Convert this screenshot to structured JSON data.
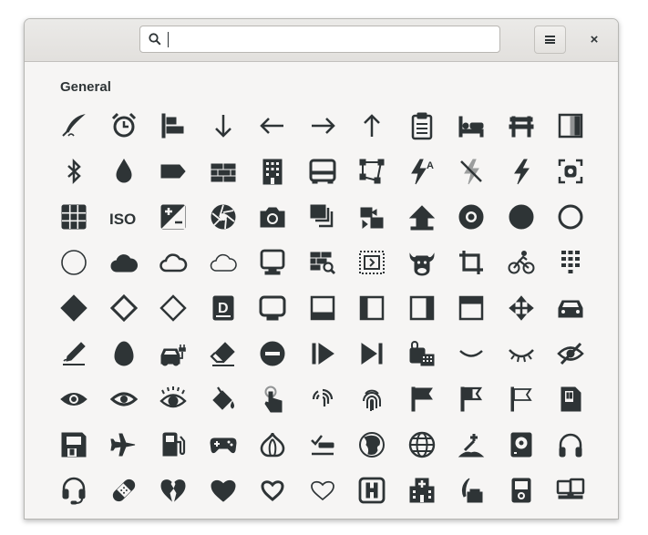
{
  "search": {
    "value": "",
    "placeholder": ""
  },
  "header": {
    "menu_icon": "open-menu-icon",
    "close_label": "×"
  },
  "section": {
    "title": "General"
  },
  "icons": [
    [
      "quill-icon",
      "alarm-clock-icon",
      "align-left-icon",
      "arrow-down-icon",
      "arrow-left-icon",
      "arrow-right-icon",
      "arrow-up-icon",
      "clipboard-list-icon",
      "bed-icon",
      "bench-icon",
      "gradient-icon"
    ],
    [
      "bluetooth-icon",
      "drop-icon",
      "label-tag-icon",
      "brick-wall-icon",
      "building-icon",
      "bus-icon",
      "vector-shape-icon",
      "flash-auto-icon",
      "flash-off-icon",
      "flash-icon",
      "focus-icon"
    ],
    [
      "grid-icon",
      "iso-icon",
      "exposure-icon",
      "aperture-icon",
      "camera-icon",
      "photo-stack-icon",
      "media-transfer-icon",
      "upload-arrow-icon",
      "disc-icon",
      "circle-filled-icon",
      "circle-thick-outline-icon"
    ],
    [
      "circle-outline-icon",
      "cloud-filled-icon",
      "cloud-outline-icon",
      "cloud-thin-icon",
      "computer-icon",
      "brick-search-icon",
      "code-frame-icon",
      "cow-icon",
      "crop-icon",
      "cyclist-icon",
      "dialpad-icon"
    ],
    [
      "diamond-filled-icon",
      "diamond-outline-icon",
      "diamond-thin-icon",
      "dictionary-icon",
      "display-icon",
      "dock-bottom-icon",
      "dock-left-icon",
      "dock-right-icon",
      "dock-top-icon",
      "move-arrows-icon",
      "car-icon"
    ],
    [
      "signature-icon",
      "egg-icon",
      "electric-car-icon",
      "eraser-icon",
      "remove-circle-icon",
      "step-forward-icon",
      "skip-next-icon",
      "keyboard-mouse-icon",
      "smile-icon",
      "eye-closed-icon",
      "eye-hidden-icon"
    ],
    [
      "eye-icon",
      "eye-outline-icon",
      "eye-lashes-icon",
      "paint-bucket-icon",
      "touch-finger-icon",
      "fingerprint-partial-icon",
      "fingerprint-icon",
      "flag-filled-icon",
      "flag-half-icon",
      "flag-outline-icon",
      "sd-card-icon"
    ],
    [
      "floppy-disk-icon",
      "airplane-icon",
      "fuel-pump-icon",
      "gamepad-icon",
      "garlic-icon",
      "checklist-icon",
      "globe-filled-icon",
      "globe-outline-icon",
      "grave-icon",
      "hard-disk-icon",
      "headphones-icon"
    ],
    [
      "headset-icon",
      "band-aid-icon",
      "heart-broken-icon",
      "heart-filled-icon",
      "heart-thick-icon",
      "heart-outline-icon",
      "hospital-sign-icon",
      "hospital-icon",
      "feather-ink-icon",
      "media-player-icon",
      "multi-monitor-icon"
    ]
  ]
}
